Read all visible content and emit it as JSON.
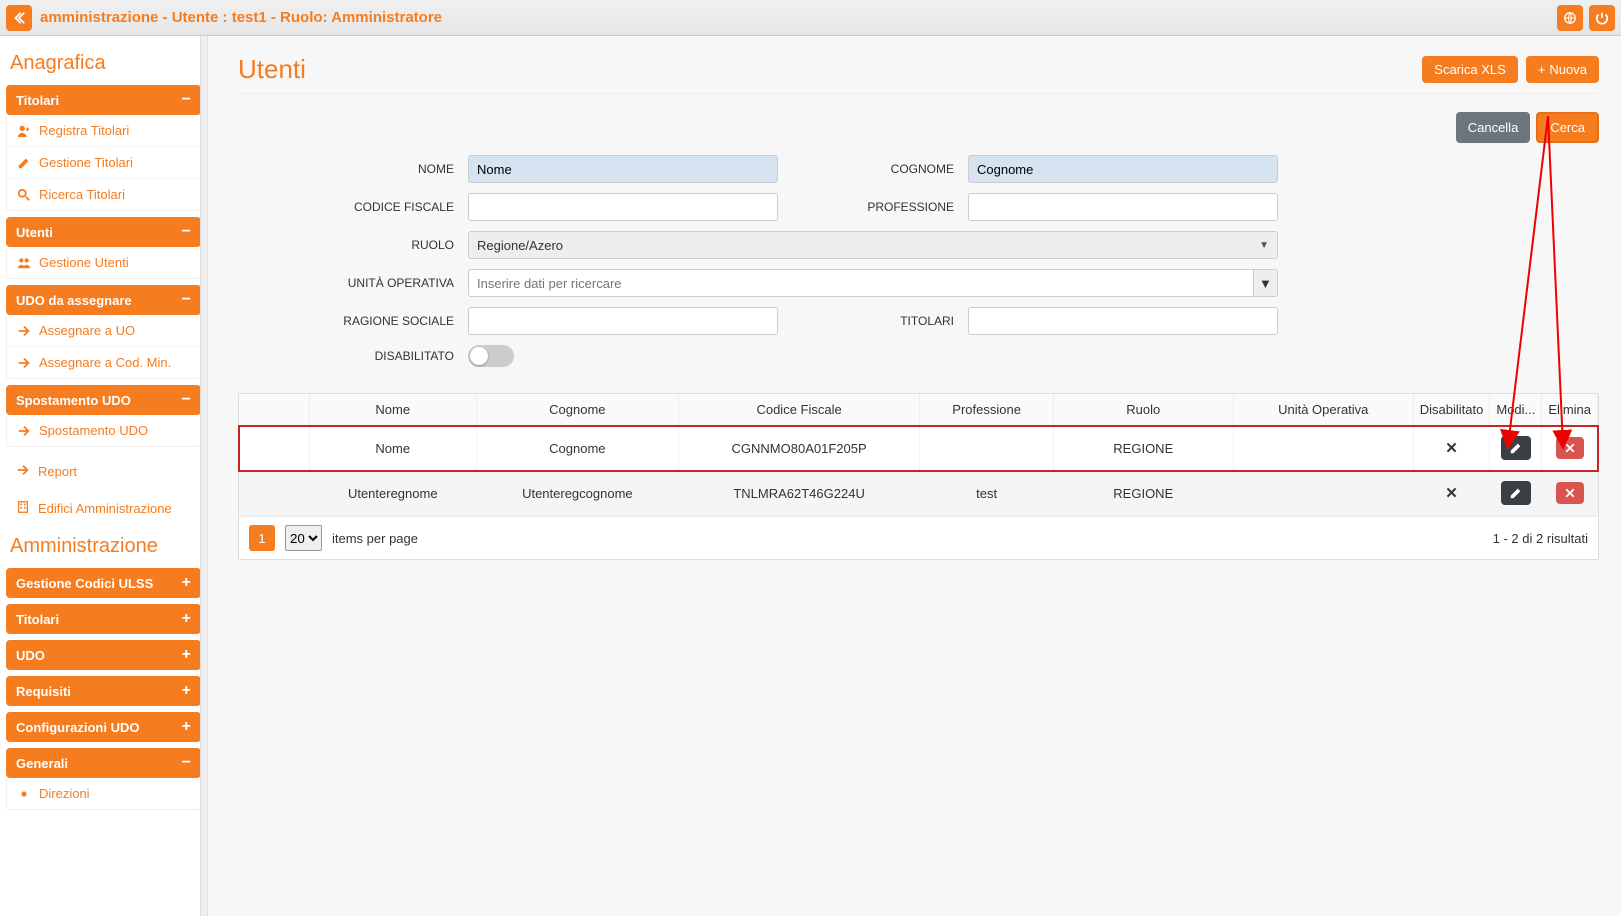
{
  "topbar": {
    "title": "amministrazione - Utente : test1 - Ruolo: Amministratore"
  },
  "sidebar": {
    "section1_title": "Anagrafica",
    "titolari": {
      "label": "Titolari",
      "items": [
        "Registra Titolari",
        "Gestione Titolari",
        "Ricerca Titolari"
      ]
    },
    "utenti": {
      "label": "Utenti",
      "items": [
        "Gestione Utenti"
      ]
    },
    "udo_assegnare": {
      "label": "UDO da assegnare",
      "items": [
        "Assegnare a UO",
        "Assegnare a Cod. Min."
      ]
    },
    "spostamento": {
      "label": "Spostamento UDO",
      "items": [
        "Spostamento UDO"
      ]
    },
    "report_link": "Report",
    "edifici_link": "Edifici Amministrazione",
    "section2_title": "Amministrazione",
    "collapsed": {
      "codici": "Gestione Codici ULSS",
      "titolari2": "Titolari",
      "udo": "UDO",
      "requisiti": "Requisiti",
      "config": "Configurazioni UDO",
      "generali": "Generali",
      "direzioni": "Direzioni"
    }
  },
  "page": {
    "title": "Utenti",
    "scarica": "Scarica XLS",
    "nuova": "Nuova",
    "cancella": "Cancella",
    "cerca": "Cerca"
  },
  "form": {
    "nome_label": "NOME",
    "nome_value": "Nome",
    "cognome_label": "COGNOME",
    "cognome_value": "Cognome",
    "cf_label": "CODICE FISCALE",
    "cf_value": "",
    "prof_label": "PROFESSIONE",
    "prof_value": "",
    "ruolo_label": "RUOLO",
    "ruolo_value": "Regione/Azero",
    "uo_label": "UNITÀ OPERATIVA",
    "uo_placeholder": "Inserire dati per ricercare",
    "ragione_label": "RAGIONE SOCIALE",
    "ragione_value": "",
    "titolari_label": "TITOLARI",
    "titolari_value": "",
    "disab_label": "DISABILITATO"
  },
  "table": {
    "headers": {
      "nome": "Nome",
      "cognome": "Cognome",
      "cf": "Codice Fiscale",
      "prof": "Professione",
      "ruolo": "Ruolo",
      "uo": "Unità Operativa",
      "disab": "Disabilitato",
      "modi": "Modi...",
      "elimina": "Elimina"
    },
    "rows": [
      {
        "nome": "Nome",
        "cognome": "Cognome",
        "cf": "CGNNMO80A01F205P",
        "prof": "",
        "ruolo": "REGIONE",
        "uo": "",
        "disab": "✕"
      },
      {
        "nome": "Utenteregnome",
        "cognome": "Utenteregcognome",
        "cf": "TNLMRA62T46G224U",
        "prof": "test",
        "ruolo": "REGIONE",
        "uo": "",
        "disab": "✕"
      }
    ],
    "page": "1",
    "perpage": "20",
    "perpage_label": "items per page",
    "results": "1 - 2 di 2 risultati"
  }
}
